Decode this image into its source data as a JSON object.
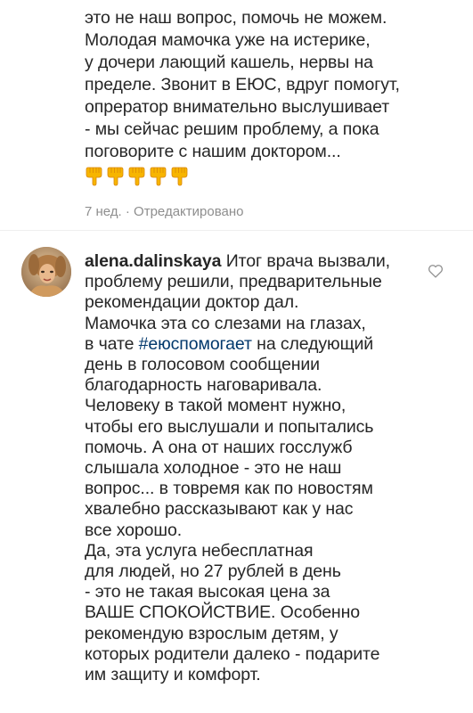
{
  "top_comment": {
    "lines": [
      "это не наш вопрос, помочь не можем.",
      "Молодая мамочка уже на истерике,",
      "у дочери лающий кашель, нервы на",
      "пределе. Звонит в ЕЮС, вдруг помогут,",
      "опрератор внимательно выслушивает",
      "- мы сейчас решим проблему, а пока",
      "поговорите с нашим доктором..."
    ],
    "emoji_count": 5,
    "emoji_icon": "backhand-index-pointing-down-icon",
    "meta": "7 нед. · Отредактировано"
  },
  "reply": {
    "username": "alena.dalinskaya",
    "first_line_rest": " Итог врача вызвали,",
    "line_2": "проблему решили, предварительные",
    "line_3": "рекомендации доктор дал.",
    "line_4": "Мамочка эта со слезами на глазах,",
    "line_5_before": "в чате ",
    "hashtag": "#еюспомогает",
    "line_5_after": " на следующий",
    "lines_rest": [
      "день в голосовом сообщении",
      "благодарность наговаривала.",
      "Человеку в такой момент нужно,",
      "чтобы его выслушали и попытались",
      "помочь. А она от наших госслужб",
      "слышала холодное - это не наш",
      "вопрос... в товремя как по новостям",
      "хвалебно рассказывают как у нас",
      "все хорошо.",
      "Да, эта услуга небесплатная",
      "для людей, но 27 рублей в день",
      "- это не такая высокая цена за",
      "ВАШЕ СПОКОЙСТВИЕ. Особенно",
      "рекомендую взрослым детям, у",
      "которых родители далеко - подарите",
      "им защиту и комфорт."
    ],
    "like_icon": "heart-outline-icon"
  },
  "colors": {
    "text": "#262626",
    "meta": "#8e8e8e",
    "hashtag": "#00376b",
    "emoji": "#f7b500"
  }
}
